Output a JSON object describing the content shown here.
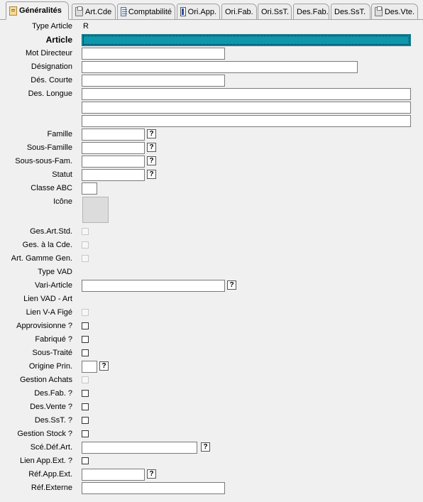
{
  "tabs": [
    {
      "label": "Généralités",
      "icon": "document-icon"
    },
    {
      "label": "Art.Cde",
      "icon": "printer-icon"
    },
    {
      "label": "Comptabilité",
      "icon": "sheet-icon"
    },
    {
      "label": "Ori.App.",
      "icon": "flag-icon"
    },
    {
      "label": "Ori.Fab.",
      "icon": ""
    },
    {
      "label": "Ori.SsT.",
      "icon": ""
    },
    {
      "label": "Des.Fab.",
      "icon": ""
    },
    {
      "label": "Des.SsT.",
      "icon": ""
    },
    {
      "label": "Des.Vte.",
      "icon": "printer-icon"
    }
  ],
  "form": {
    "type_article": {
      "label": "Type Article",
      "value": "R"
    },
    "article": {
      "label": "Article",
      "value": ""
    },
    "mot_directeur": {
      "label": "Mot Directeur",
      "value": ""
    },
    "designation": {
      "label": "Désignation",
      "value": ""
    },
    "des_courte": {
      "label": "Dés. Courte",
      "value": ""
    },
    "des_longue": {
      "label": "Des. Longue",
      "value": ""
    },
    "famille": {
      "label": "Famille",
      "value": "",
      "help": "?"
    },
    "sous_famille": {
      "label": "Sous-Famille",
      "value": "",
      "help": "?"
    },
    "sous_sous_fam": {
      "label": "Sous-sous-Fam.",
      "value": "",
      "help": "?"
    },
    "statut": {
      "label": "Statut",
      "value": "",
      "help": "?"
    },
    "classe_abc": {
      "label": "Classe ABC",
      "value": ""
    },
    "icone": {
      "label": "Icône"
    },
    "ges_art_std": {
      "label": "Ges.Art.Std.",
      "checked": false,
      "enabled": false
    },
    "ges_a_la_cde": {
      "label": "Ges. à la Cde.",
      "checked": false,
      "enabled": false
    },
    "art_gamme_gen": {
      "label": "Art. Gamme Gen.",
      "checked": false,
      "enabled": false
    },
    "type_vad": {
      "label": "Type VAD"
    },
    "vari_article": {
      "label": "Vari-Article",
      "value": "",
      "help": "?"
    },
    "lien_vad_art": {
      "label": "Lien VAD - Art"
    },
    "lien_va_fige": {
      "label": "Lien V-A Figé",
      "checked": false,
      "enabled": false
    },
    "approvisionne": {
      "label": "Approvisionne ?",
      "checked": false,
      "enabled": true
    },
    "fabrique": {
      "label": "Fabriqué ?",
      "checked": false,
      "enabled": true
    },
    "sous_traite": {
      "label": "Sous-Traité",
      "checked": false,
      "enabled": true
    },
    "origine_prin": {
      "label": "Origine Prin.",
      "value": "",
      "help": "?"
    },
    "gestion_achats": {
      "label": "Gestion Achats",
      "checked": false,
      "enabled": false
    },
    "des_fab": {
      "label": "Des.Fab. ?",
      "checked": false,
      "enabled": true
    },
    "des_vente": {
      "label": "Des.Vente ?",
      "checked": false,
      "enabled": true
    },
    "des_sst": {
      "label": "Des.SsT. ?",
      "checked": false,
      "enabled": true
    },
    "gestion_stock": {
      "label": "Gestion Stock ?",
      "checked": false,
      "enabled": true
    },
    "sce_def_art": {
      "label": "Scé.Déf.Art.",
      "value": "",
      "help": "?"
    },
    "lien_app_ext": {
      "label": "Lien App.Ext. ?",
      "checked": false,
      "enabled": true
    },
    "ref_app_ext": {
      "label": "Réf.App.Ext.",
      "value": "",
      "help": "?"
    },
    "ref_externe": {
      "label": "Réf.Externe",
      "value": ""
    }
  },
  "colors": {
    "article_highlight": "#0e97aa",
    "background": "#f0f0f0"
  }
}
